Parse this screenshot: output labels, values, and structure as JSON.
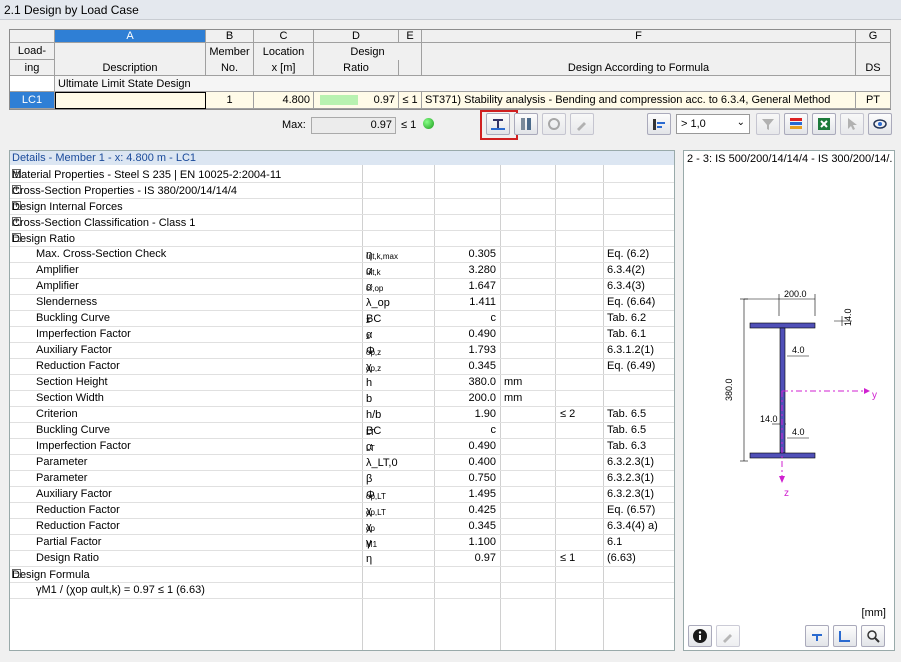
{
  "window_title": "2.1 Design by Load Case",
  "columns": {
    "letters": [
      "A",
      "B",
      "C",
      "D",
      "E",
      "F",
      "G"
    ],
    "h1": {
      "loading": "Load-",
      "member": "Member",
      "location": "Location",
      "design": "Design"
    },
    "h2": {
      "loading": "ing",
      "description": "Description",
      "member": "No.",
      "location": "x [m]",
      "ratio": "Ratio",
      "formula": "Design According to Formula",
      "ds": "DS"
    }
  },
  "group_label": "Ultimate Limit State Design",
  "row": {
    "loading": "LC1",
    "member": "1",
    "location": "4.800",
    "ratio": "0.97",
    "le": "≤ 1",
    "formula": "ST371) Stability analysis - Bending and compression acc. to 6.3.4, General Method",
    "ds": "PT"
  },
  "max": {
    "label": "Max:",
    "value": "0.97",
    "le": "≤ 1",
    "filter": "> 1,0"
  },
  "details": {
    "title": "Details - Member 1 - x: 4.800 m - LC1",
    "sections": [
      "Material Properties - Steel S 235 | EN 10025-2:2004-11",
      "Cross-Section Properties  -  IS 380/200/14/14/4",
      "Design Internal Forces",
      "Cross-Section Classification - Class 1",
      "Design Ratio"
    ],
    "rows": [
      {
        "n": "Max. Cross-Section Check",
        "s": "η",
        "sub": "ult,k,max",
        "v": "0.305",
        "u": "",
        "c": "",
        "r": "Eq. (6.2)"
      },
      {
        "n": "Amplifier",
        "s": "α",
        "sub": "ult,k",
        "v": "3.280",
        "u": "",
        "c": "",
        "r": "6.3.4(2)"
      },
      {
        "n": "Amplifier",
        "s": "α",
        "sub": "cr,op",
        "v": "1.647",
        "u": "",
        "c": "",
        "r": "6.3.4(3)"
      },
      {
        "n": "Slenderness",
        "s": "λ_op",
        "sub": "",
        "v": "1.411",
        "u": "",
        "c": "",
        "r": "Eq. (6.64)"
      },
      {
        "n": "Buckling Curve",
        "s": "BC",
        "sub": "z",
        "v": "c",
        "u": "",
        "c": "",
        "r": "Tab. 6.2"
      },
      {
        "n": "Imperfection Factor",
        "s": "α",
        "sub": "z",
        "v": "0.490",
        "u": "",
        "c": "",
        "r": "Tab. 6.1"
      },
      {
        "n": "Auxiliary Factor",
        "s": "Φ",
        "sub": "op,z",
        "v": "1.793",
        "u": "",
        "c": "",
        "r": "6.3.1.2(1)"
      },
      {
        "n": "Reduction Factor",
        "s": "χ",
        "sub": "op,z",
        "v": "0.345",
        "u": "",
        "c": "",
        "r": "Eq. (6.49)"
      },
      {
        "n": "Section Height",
        "s": "h",
        "sub": "",
        "v": "380.0",
        "u": "mm",
        "c": "",
        "r": ""
      },
      {
        "n": "Section Width",
        "s": "b",
        "sub": "",
        "v": "200.0",
        "u": "mm",
        "c": "",
        "r": ""
      },
      {
        "n": "Criterion",
        "s": "h/b",
        "sub": "",
        "v": "1.90",
        "u": "",
        "c": "≤ 2",
        "r": "Tab. 6.5"
      },
      {
        "n": "Buckling Curve",
        "s": "BC",
        "sub": "LT",
        "v": "c",
        "u": "",
        "c": "",
        "r": "Tab. 6.5"
      },
      {
        "n": "Imperfection Factor",
        "s": "α",
        "sub": "LT",
        "v": "0.490",
        "u": "",
        "c": "",
        "r": "Tab. 6.3"
      },
      {
        "n": "Parameter",
        "s": "λ_LT,0",
        "sub": "",
        "v": "0.400",
        "u": "",
        "c": "",
        "r": "6.3.2.3(1)"
      },
      {
        "n": "Parameter",
        "s": "β",
        "sub": "",
        "v": "0.750",
        "u": "",
        "c": "",
        "r": "6.3.2.3(1)"
      },
      {
        "n": "Auxiliary Factor",
        "s": "Φ",
        "sub": "op,LT",
        "v": "1.495",
        "u": "",
        "c": "",
        "r": "6.3.2.3(1)"
      },
      {
        "n": "Reduction Factor",
        "s": "χ",
        "sub": "op,LT",
        "v": "0.425",
        "u": "",
        "c": "",
        "r": "Eq. (6.57)"
      },
      {
        "n": "Reduction Factor",
        "s": "χ",
        "sub": "op",
        "v": "0.345",
        "u": "",
        "c": "",
        "r": "6.3.4(4) a)"
      },
      {
        "n": "Partial Factor",
        "s": "γ",
        "sub": "M1",
        "v": "1.100",
        "u": "",
        "c": "",
        "r": "6.1"
      },
      {
        "n": "Design Ratio",
        "s": "η",
        "sub": "",
        "v": "0.97",
        "u": "",
        "c": "≤ 1",
        "r": "(6.63)"
      }
    ],
    "formula_section": "Design Formula",
    "formula": "γM1 / (χop αult,k) = 0.97 ≤ 1   (6.63)"
  },
  "graphic": {
    "title": "2 - 3: IS 500/200/14/14/4 - IS 300/200/14/...",
    "dim_width": "200.0",
    "dim_flange": "14.0",
    "dim_web": "4.0",
    "dim_height": "380.0",
    "dim_web2": "14.0",
    "dim_weld": "4.0",
    "axis_y": "y",
    "axis_z": "z",
    "unit": "[mm]"
  }
}
